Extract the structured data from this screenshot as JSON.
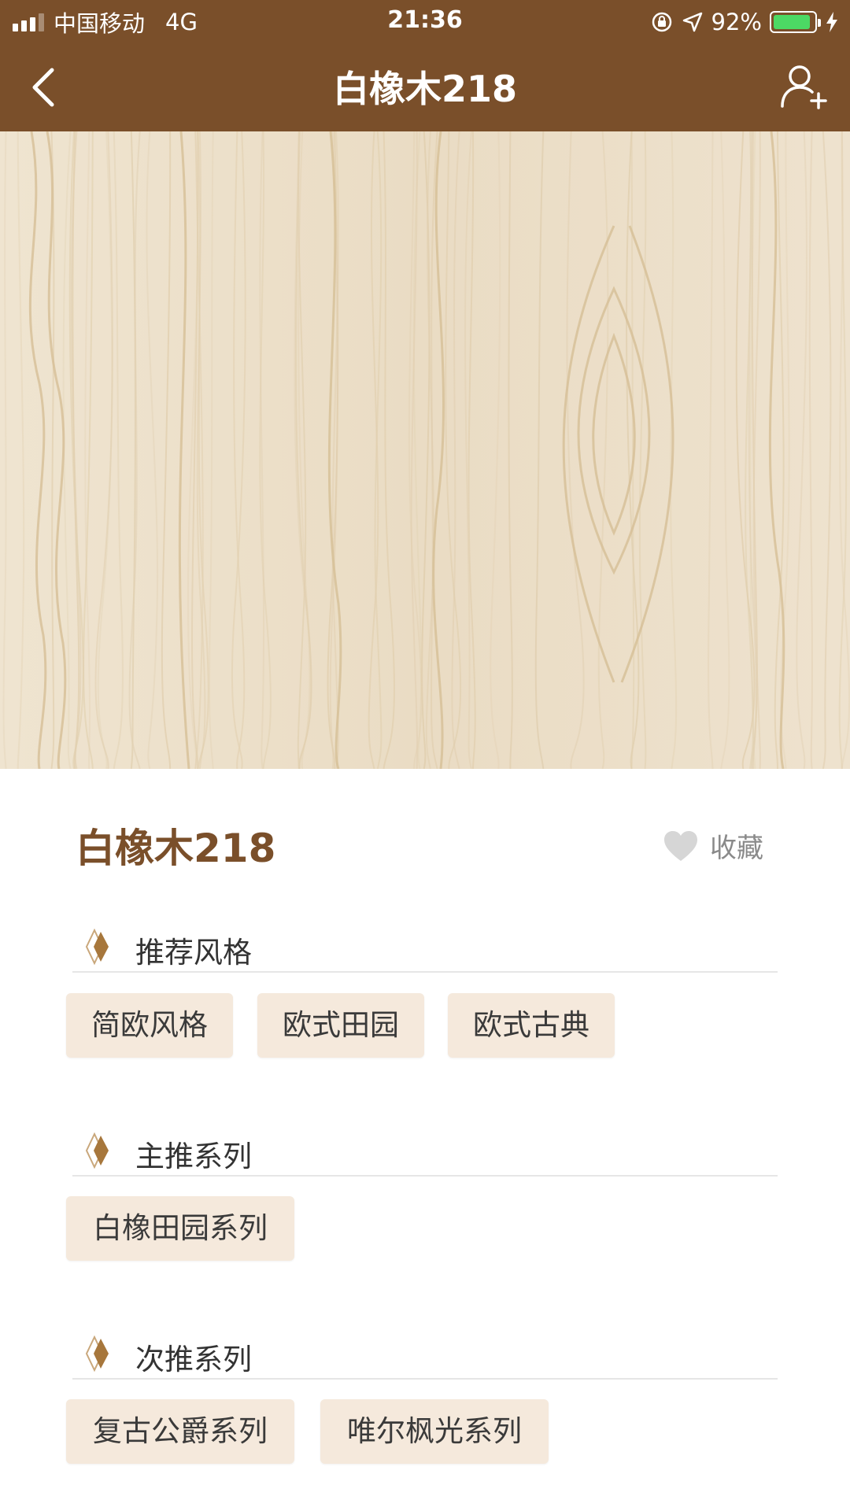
{
  "status_bar": {
    "carrier": "中国移动",
    "network": "4G",
    "time": "21:36",
    "battery_percent": "92%",
    "battery_level": 0.92
  },
  "nav": {
    "title": "白橡木218",
    "back_icon": "chevron-left-icon",
    "right_icon": "add-user-icon"
  },
  "product": {
    "name": "白橡木218",
    "favorite_label": "收藏"
  },
  "sections": [
    {
      "title": "推荐风格",
      "tags": [
        "简欧风格",
        "欧式田园",
        "欧式古典"
      ]
    },
    {
      "title": "主推系列",
      "tags": [
        "白橡田园系列"
      ]
    },
    {
      "title": "次推系列",
      "tags": [
        "复古公爵系列",
        "唯尔枫光系列"
      ]
    }
  ],
  "colors": {
    "brand": "#7a4f2a",
    "tag_background": "#f5e9dc",
    "wood": "#ede1cc",
    "accent_diamond": "#a7773c"
  }
}
